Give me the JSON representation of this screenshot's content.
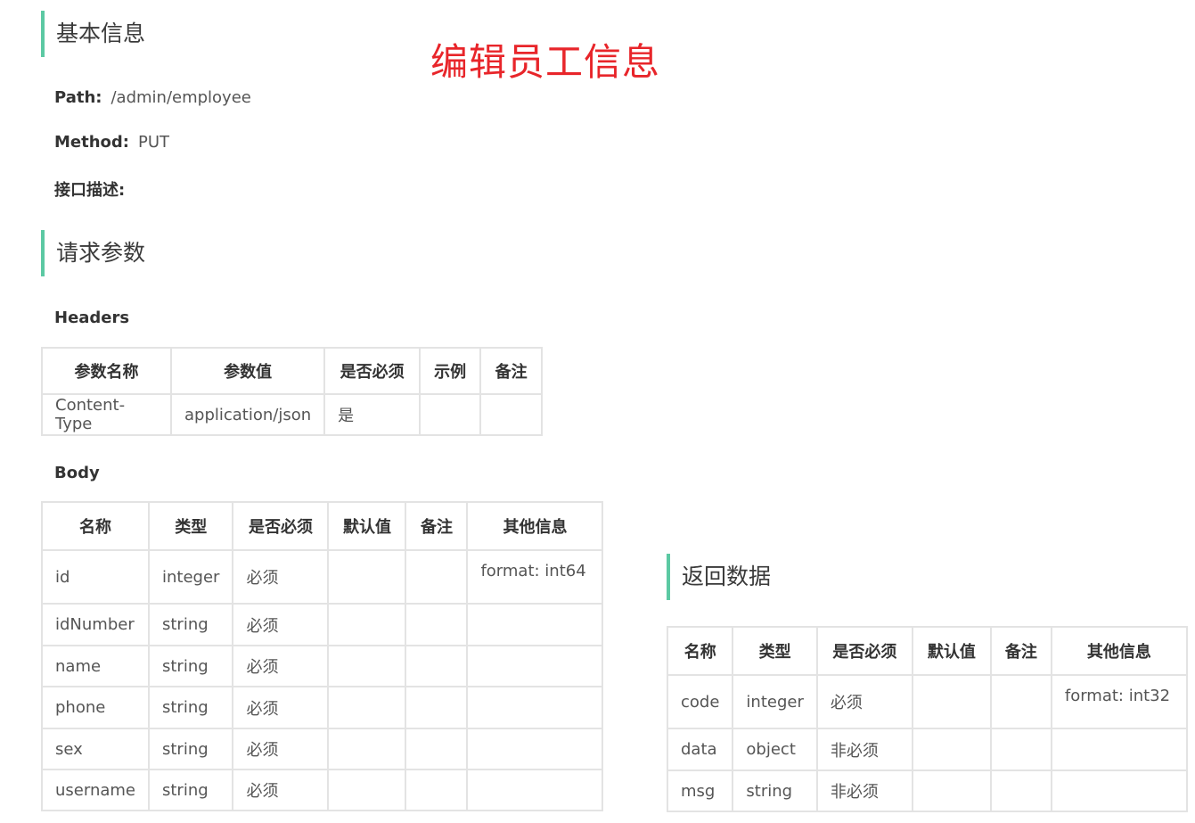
{
  "basic": {
    "heading": "基本信息",
    "overlay_title": "编辑员工信息",
    "path_label": "Path:",
    "path_value": "/admin/employee",
    "method_label": "Method:",
    "method_value": "PUT",
    "desc_label": "接口描述:"
  },
  "request": {
    "heading": "请求参数",
    "headers_label": "Headers",
    "headers_table": {
      "columns": [
        "参数名称",
        "参数值",
        "是否必须",
        "示例",
        "备注"
      ],
      "rows": [
        [
          "Content-Type",
          "application/json",
          "是",
          "",
          ""
        ]
      ]
    },
    "body_label": "Body",
    "body_table": {
      "columns": [
        "名称",
        "类型",
        "是否必须",
        "默认值",
        "备注",
        "其他信息"
      ],
      "rows": [
        [
          "id",
          "integer",
          "必须",
          "",
          "",
          "format: int64"
        ],
        [
          "idNumber",
          "string",
          "必须",
          "",
          "",
          ""
        ],
        [
          "name",
          "string",
          "必须",
          "",
          "",
          ""
        ],
        [
          "phone",
          "string",
          "必须",
          "",
          "",
          ""
        ],
        [
          "sex",
          "string",
          "必须",
          "",
          "",
          ""
        ],
        [
          "username",
          "string",
          "必须",
          "",
          "",
          ""
        ]
      ]
    }
  },
  "response": {
    "heading": "返回数据",
    "table": {
      "columns": [
        "名称",
        "类型",
        "是否必须",
        "默认值",
        "备注",
        "其他信息"
      ],
      "rows": [
        [
          "code",
          "integer",
          "必须",
          "",
          "",
          "format: int32"
        ],
        [
          "data",
          "object",
          "非必须",
          "",
          "",
          ""
        ],
        [
          "msg",
          "string",
          "非必须",
          "",
          "",
          ""
        ]
      ]
    }
  },
  "colors": {
    "accent": "#5cc9a3",
    "overlay_title": "#e8252a",
    "border": "#e3e3e3"
  }
}
